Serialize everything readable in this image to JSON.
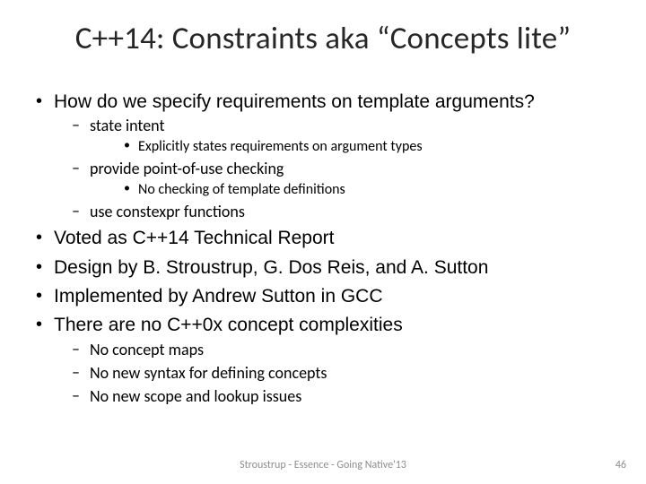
{
  "title": "C++14: Constraints aka “Concepts lite”",
  "bullets": {
    "b1": "How do we specify requirements on template arguments?",
    "b1a": "state intent",
    "b1a1": "Explicitly states requirements on argument types",
    "b1b": "provide point-of-use checking",
    "b1b1": "No checking of template definitions",
    "b1c": "use constexpr functions",
    "b2": "Voted as C++14 Technical Report",
    "b3": "Design by B. Stroustrup, G. Dos Reis, and A. Sutton",
    "b4": "Implemented by Andrew Sutton in GCC",
    "b5": "There are no C++0x concept complexities",
    "b5a": "No concept maps",
    "b5b": "No new syntax for defining concepts",
    "b5c": "No new scope and lookup issues"
  },
  "footer": "Stroustrup - Essence - Going Native'13",
  "page": "46"
}
